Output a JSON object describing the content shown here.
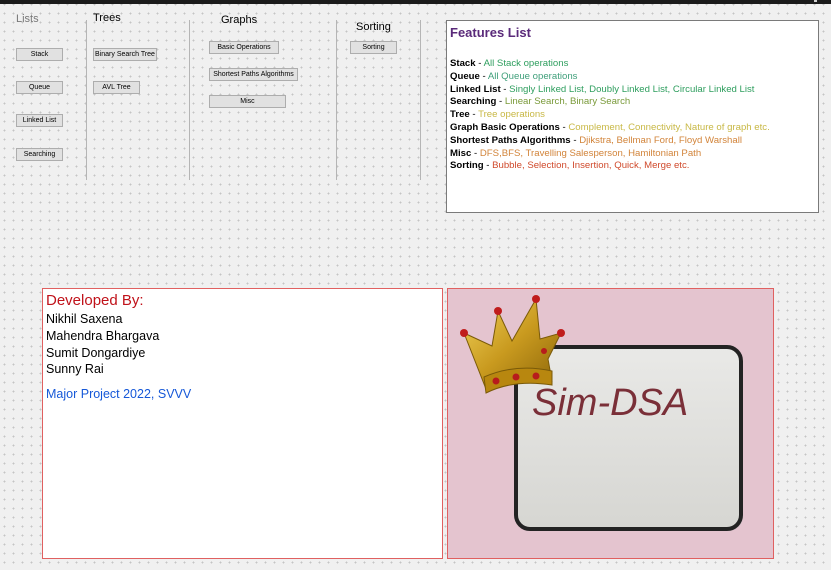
{
  "sections": {
    "lists": {
      "title": "Lists",
      "buttons": [
        "Stack",
        "Queue",
        "Linked List",
        "Searching"
      ]
    },
    "trees": {
      "title": "Trees",
      "buttons": [
        "Binary Search Tree",
        "AVL Tree"
      ]
    },
    "graphs": {
      "title": "Graphs",
      "buttons": [
        "Basic Operations",
        "Shortest Paths Algorithms",
        "Misc"
      ]
    },
    "sorting": {
      "title": "Sorting",
      "buttons": [
        "Sorting"
      ]
    }
  },
  "features": {
    "title": "Features List",
    "items": [
      {
        "key": "Stack",
        "value": "All Stack operations",
        "color": "#2e9e5e"
      },
      {
        "key": "Queue",
        "value": "All Queue operations",
        "color": "#3f9f7a"
      },
      {
        "key": "Linked List",
        "value": "Singly Linked List, Doubly Linked List, Circular Linked List",
        "color": "#2e9e5e"
      },
      {
        "key": "Searching",
        "value": "Linear Search, Binary Search",
        "color": "#7a9a3a"
      },
      {
        "key": "Tree",
        "value": "Tree operations",
        "color": "#c8b845"
      },
      {
        "key": "Graph Basic Operations",
        "value": "Complement, Connectivity, Nature of graph etc.",
        "color": "#c8b845"
      },
      {
        "key": "Shortest Paths Algorithms",
        "value": "Djikstra, Bellman Ford, Floyd Warshall",
        "color": "#d2843a"
      },
      {
        "key": "Misc",
        "value": "DFS,BFS, Travelling Salesperson, Hamiltonian Path",
        "color": "#d2843a"
      },
      {
        "key": "Sorting",
        "value": "Bubble, Selection, Insertion, Quick, Merge etc.",
        "color": "#d04a2c"
      }
    ],
    "separator": " - "
  },
  "developers": {
    "heading": "Developed By:",
    "names": [
      "Nikhil Saxena",
      "Mahendra Bhargava",
      "Sumit Dongardiye",
      "Sunny Rai"
    ],
    "project": "Major Project 2022, SVVV"
  },
  "logo": {
    "text": "Sim-DSA",
    "icon": "crown-icon"
  }
}
